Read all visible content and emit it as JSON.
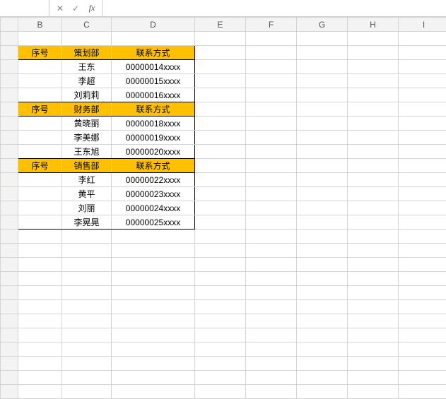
{
  "formula_bar": {
    "name_box": "",
    "cancel": "✕",
    "confirm": "✓",
    "fx": "fx",
    "input": ""
  },
  "columns": [
    "B",
    "C",
    "D",
    "E",
    "F",
    "G",
    "H",
    "I"
  ],
  "sections": [
    {
      "header": {
        "seq": "序号",
        "dept": "策划部",
        "contact": "联系方式"
      },
      "rows": [
        {
          "seq": "",
          "name": "王东",
          "contact": "00000014xxxx"
        },
        {
          "seq": "",
          "name": "李超",
          "contact": "00000015xxxx"
        },
        {
          "seq": "",
          "name": "刘莉莉",
          "contact": "00000016xxxx"
        }
      ]
    },
    {
      "header": {
        "seq": "序号",
        "dept": "财务部",
        "contact": "联系方式"
      },
      "rows": [
        {
          "seq": "",
          "name": "黄晓丽",
          "contact": "00000018xxxx"
        },
        {
          "seq": "",
          "name": "李美娜",
          "contact": "00000019xxxx"
        },
        {
          "seq": "",
          "name": "王东旭",
          "contact": "00000020xxxx"
        }
      ]
    },
    {
      "header": {
        "seq": "序号",
        "dept": "销售部",
        "contact": "联系方式"
      },
      "rows": [
        {
          "seq": "",
          "name": "李红",
          "contact": "00000022xxxx"
        },
        {
          "seq": "",
          "name": "黄平",
          "contact": "00000023xxxx"
        },
        {
          "seq": "",
          "name": "刘丽",
          "contact": "00000024xxxx"
        },
        {
          "seq": "",
          "name": "李晃晃",
          "contact": "00000025xxxx"
        }
      ]
    }
  ]
}
